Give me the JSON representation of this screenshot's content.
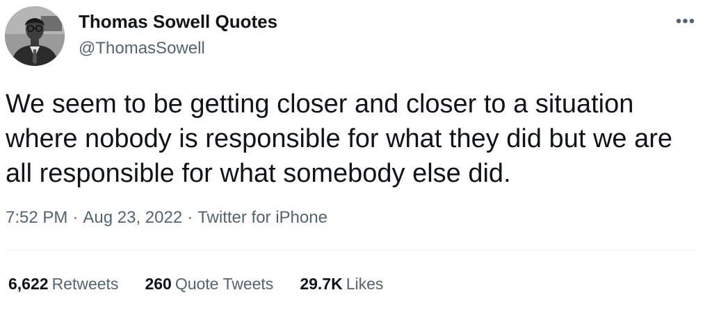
{
  "author": {
    "name": "Thomas Sowell Quotes",
    "handle": "@ThomasSowell",
    "avatar_icon": "person-portrait-icon"
  },
  "more_icon": "more-options-icon",
  "tweet": {
    "text": "We seem to be getting closer and closer to a situation where nobody is responsible for what they did but we are all responsible for what somebody else did.",
    "time": "7:52 PM",
    "date": "Aug 23, 2022",
    "separator": "·",
    "source": "Twitter for iPhone"
  },
  "stats": {
    "retweets_count": "6,622",
    "retweets_label": "Retweets",
    "quotes_count": "260",
    "quotes_label": "Quote Tweets",
    "likes_count": "29.7K",
    "likes_label": "Likes"
  },
  "colors": {
    "text_primary": "#0f1419",
    "text_secondary": "#536471",
    "divider": "#eff3f4"
  }
}
